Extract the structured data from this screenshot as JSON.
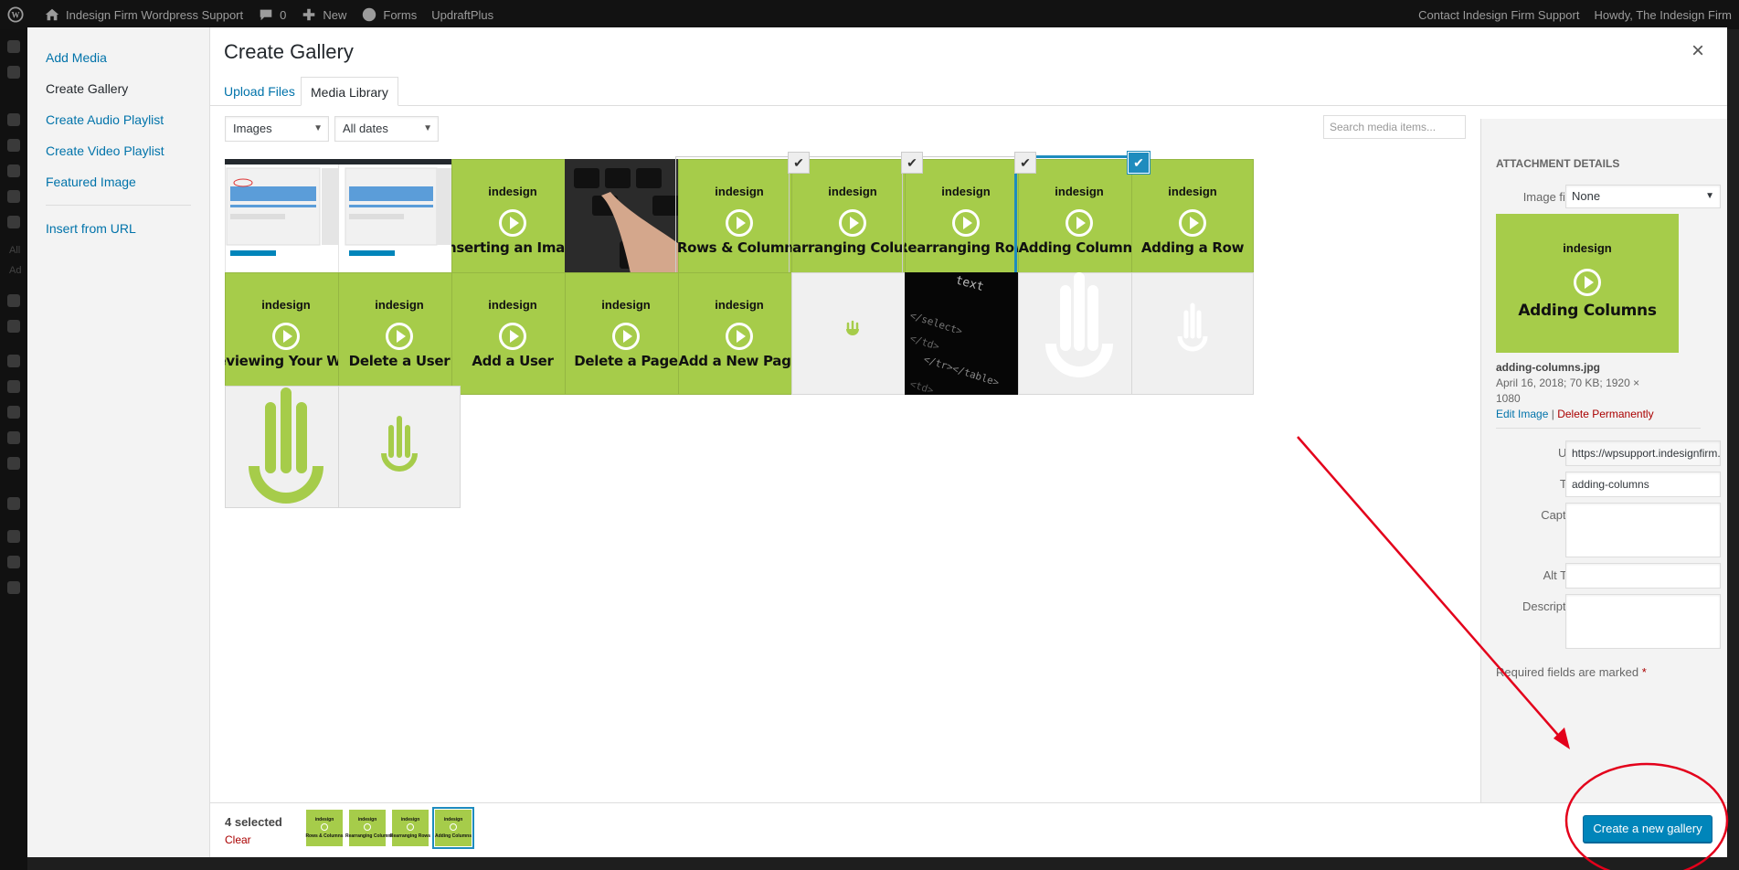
{
  "admin_bar": {
    "site_name": "Indesign Firm Wordpress Support",
    "comments_count": "0",
    "new_label": "New",
    "forms_label": "Forms",
    "updraft_label": "UpdraftPlus",
    "contact_label": "Contact Indesign Firm Support",
    "howdy_label": "Howdy, The Indesign Firm"
  },
  "admin_menu": {
    "all_label": "All",
    "add_label": "Ad"
  },
  "media_menu": {
    "items": [
      "Add Media",
      "Create Gallery",
      "Create Audio Playlist",
      "Create Video Playlist",
      "Featured Image"
    ],
    "insert_url": "Insert from URL"
  },
  "modal": {
    "title": "Create Gallery",
    "close": "×"
  },
  "router": {
    "upload_tab": "Upload Files",
    "library_tab": "Media Library"
  },
  "filters": {
    "type": "Images",
    "date": "All dates",
    "search_placeholder": "Search media items..."
  },
  "grid": {
    "logo_text": "indesign",
    "captions": {
      "inserting_image": "Inserting an Image",
      "rows_columns": "Rows & Columns",
      "rearranging_columns": "Rearranging Columns",
      "rearranging_rows": "Rearranging Rows",
      "adding_columns": "Adding Columns",
      "adding_row": "Adding a Row",
      "reviewing": "Reviewing Your Work",
      "delete_user": "Delete a User",
      "add_user": "Add a User",
      "delete_page": "Delete a Page",
      "add_page": "Add a New Page"
    },
    "code_text": "text",
    "code_lines": [
      "</select>",
      "</td>",
      "</tr></table>",
      "<td>"
    ]
  },
  "details": {
    "heading": "Attachment Details",
    "image_filter_label": "Image filter",
    "image_filter_value": "None",
    "preview_caption": "Adding Columns",
    "filename": "adding-columns.jpg",
    "meta_line": "April 16, 2018;  70 KB;  1920 ×",
    "meta_line2": "1080",
    "edit_image": "Edit Image",
    "meta_sep": "|",
    "delete_permanently": "Delete Permanently",
    "url_label": "URL",
    "url_value": "https://wpsupport.indesignfirm.com/",
    "title_label": "Title",
    "title_value": "adding-columns",
    "caption_label": "Caption",
    "alt_label": "Alt Text",
    "description_label": "Description",
    "required_note": "Required fields are marked",
    "required_star": "*"
  },
  "selection": {
    "count_label": "4 selected",
    "clear_label": "Clear",
    "mini_captions": [
      "Rows & Columns",
      "Rearranging Columns",
      "Rearranging Rows",
      "Adding Columns"
    ]
  },
  "actions": {
    "create_button": "Create a new gallery"
  },
  "colors": {
    "accent": "#0085ba",
    "video_green": "#a6cc4a",
    "annotation_red": "#e3001b"
  }
}
